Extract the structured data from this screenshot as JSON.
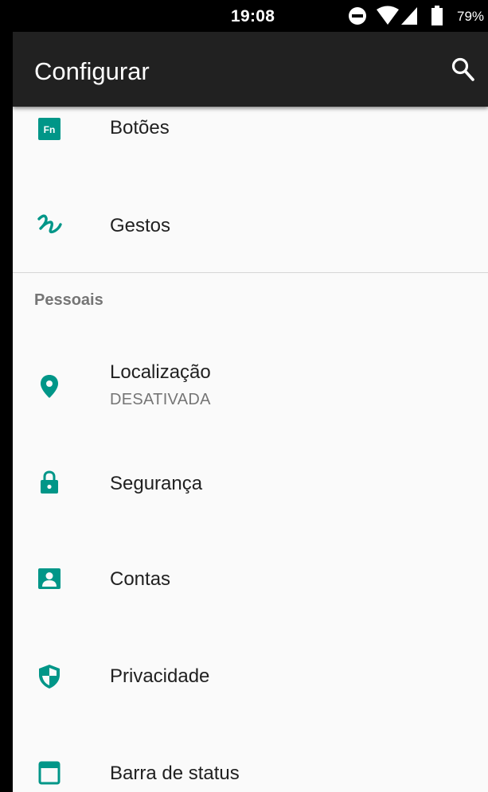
{
  "status_bar": {
    "time": "19:08",
    "battery": "79%",
    "icons": [
      "do-not-disturb-icon",
      "wifi-icon",
      "signal-icon",
      "battery-icon"
    ]
  },
  "app_bar": {
    "title": "Configurar",
    "search_icon": "search-icon"
  },
  "accent_color": "#009688",
  "items_top": [
    {
      "label": "Botões",
      "icon": "fn-key-icon"
    },
    {
      "label": "Gestos",
      "icon": "gesture-icon"
    }
  ],
  "section": {
    "header": "Pessoais"
  },
  "items_personal": [
    {
      "label": "Localização",
      "subtitle": "DESATIVADA",
      "icon": "location-pin-icon"
    },
    {
      "label": "Segurança",
      "icon": "lock-icon"
    },
    {
      "label": "Contas",
      "icon": "account-icon"
    },
    {
      "label": "Privacidade",
      "icon": "shield-icon"
    },
    {
      "label": "Barra de status",
      "icon": "status-bar-icon"
    }
  ]
}
